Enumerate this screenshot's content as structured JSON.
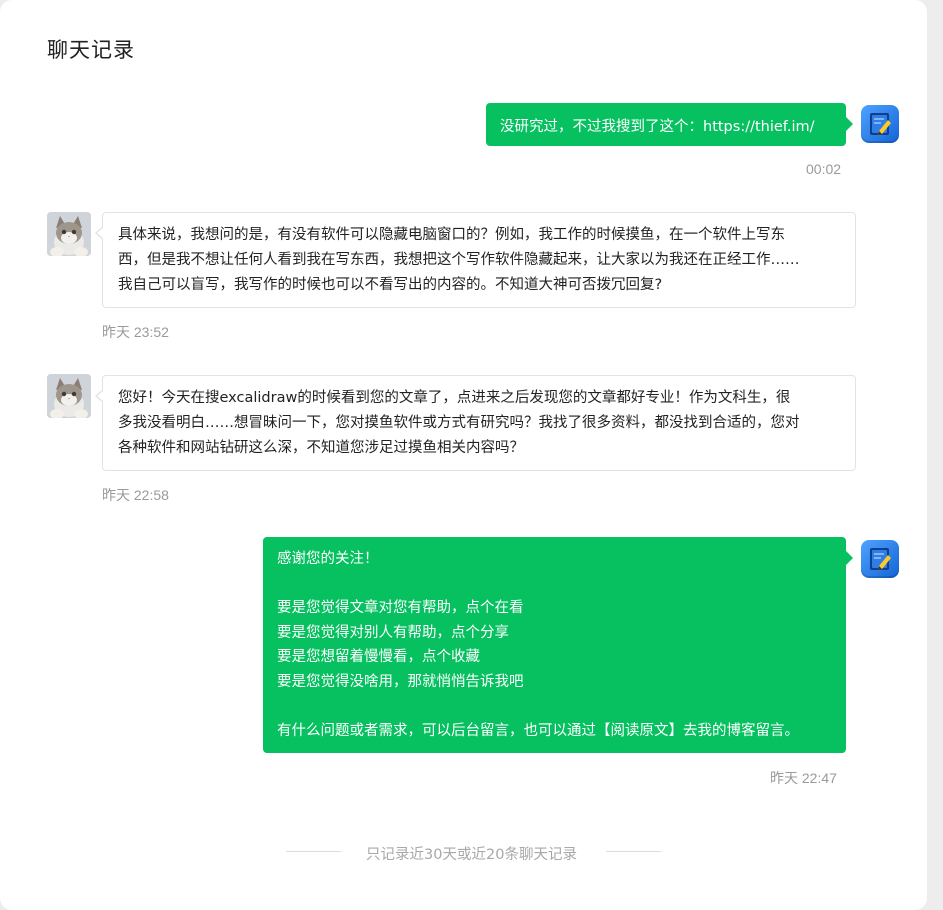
{
  "header": {
    "title": "聊天记录"
  },
  "messages": [
    {
      "sender": "me",
      "lines": [
        "没研究过，不过我搜到了这个：https://thief.im/"
      ],
      "time": "00:02"
    },
    {
      "sender": "user",
      "lines": [
        "具体来说，我想问的是，有没有软件可以隐藏电脑窗口的？例如，我工作的时候摸鱼，在一个软件上写东",
        "西，但是我不想让任何人看到我在写东西，我想把这个写作软件隐藏起来，让大家以为我还在正经工作……",
        "我自己可以盲写，我写作的时候也可以不看写出的内容的。不知道大神可否拨冗回复?"
      ],
      "time": "昨天 23:52"
    },
    {
      "sender": "user",
      "lines": [
        "您好！今天在搜excalidraw的时候看到您的文章了，点进来之后发现您的文章都好专业！作为文科生，很",
        "多我没看明白……想冒昧问一下，您对摸鱼软件或方式有研究吗？我找了很多资料，都没找到合适的，您对",
        "各种软件和网站钻研这么深，不知道您涉足过摸鱼相关内容吗？"
      ],
      "time": "昨天 22:58"
    },
    {
      "sender": "me",
      "lines": [
        "感谢您的关注！",
        "",
        "要是您觉得文章对您有帮助，点个在看",
        "要是您觉得对别人有帮助，点个分享",
        "要是您想留着慢慢看，点个收藏",
        "要是您觉得没啥用，那就悄悄告诉我吧",
        "",
        "有什么问题或者需求，可以后台留言，也可以通过【阅读原文】去我的博客留言。"
      ],
      "time": "昨天 22:47"
    }
  ],
  "footer": {
    "note": "只记录近30天或近20条聊天记录"
  },
  "colors": {
    "accent": "#07c160",
    "background": "#ededed",
    "timestamp": "#9a9a9a"
  },
  "icons": {
    "my_avatar": "notepad-pencil-app-icon",
    "user_avatar": "kitten-photo"
  }
}
